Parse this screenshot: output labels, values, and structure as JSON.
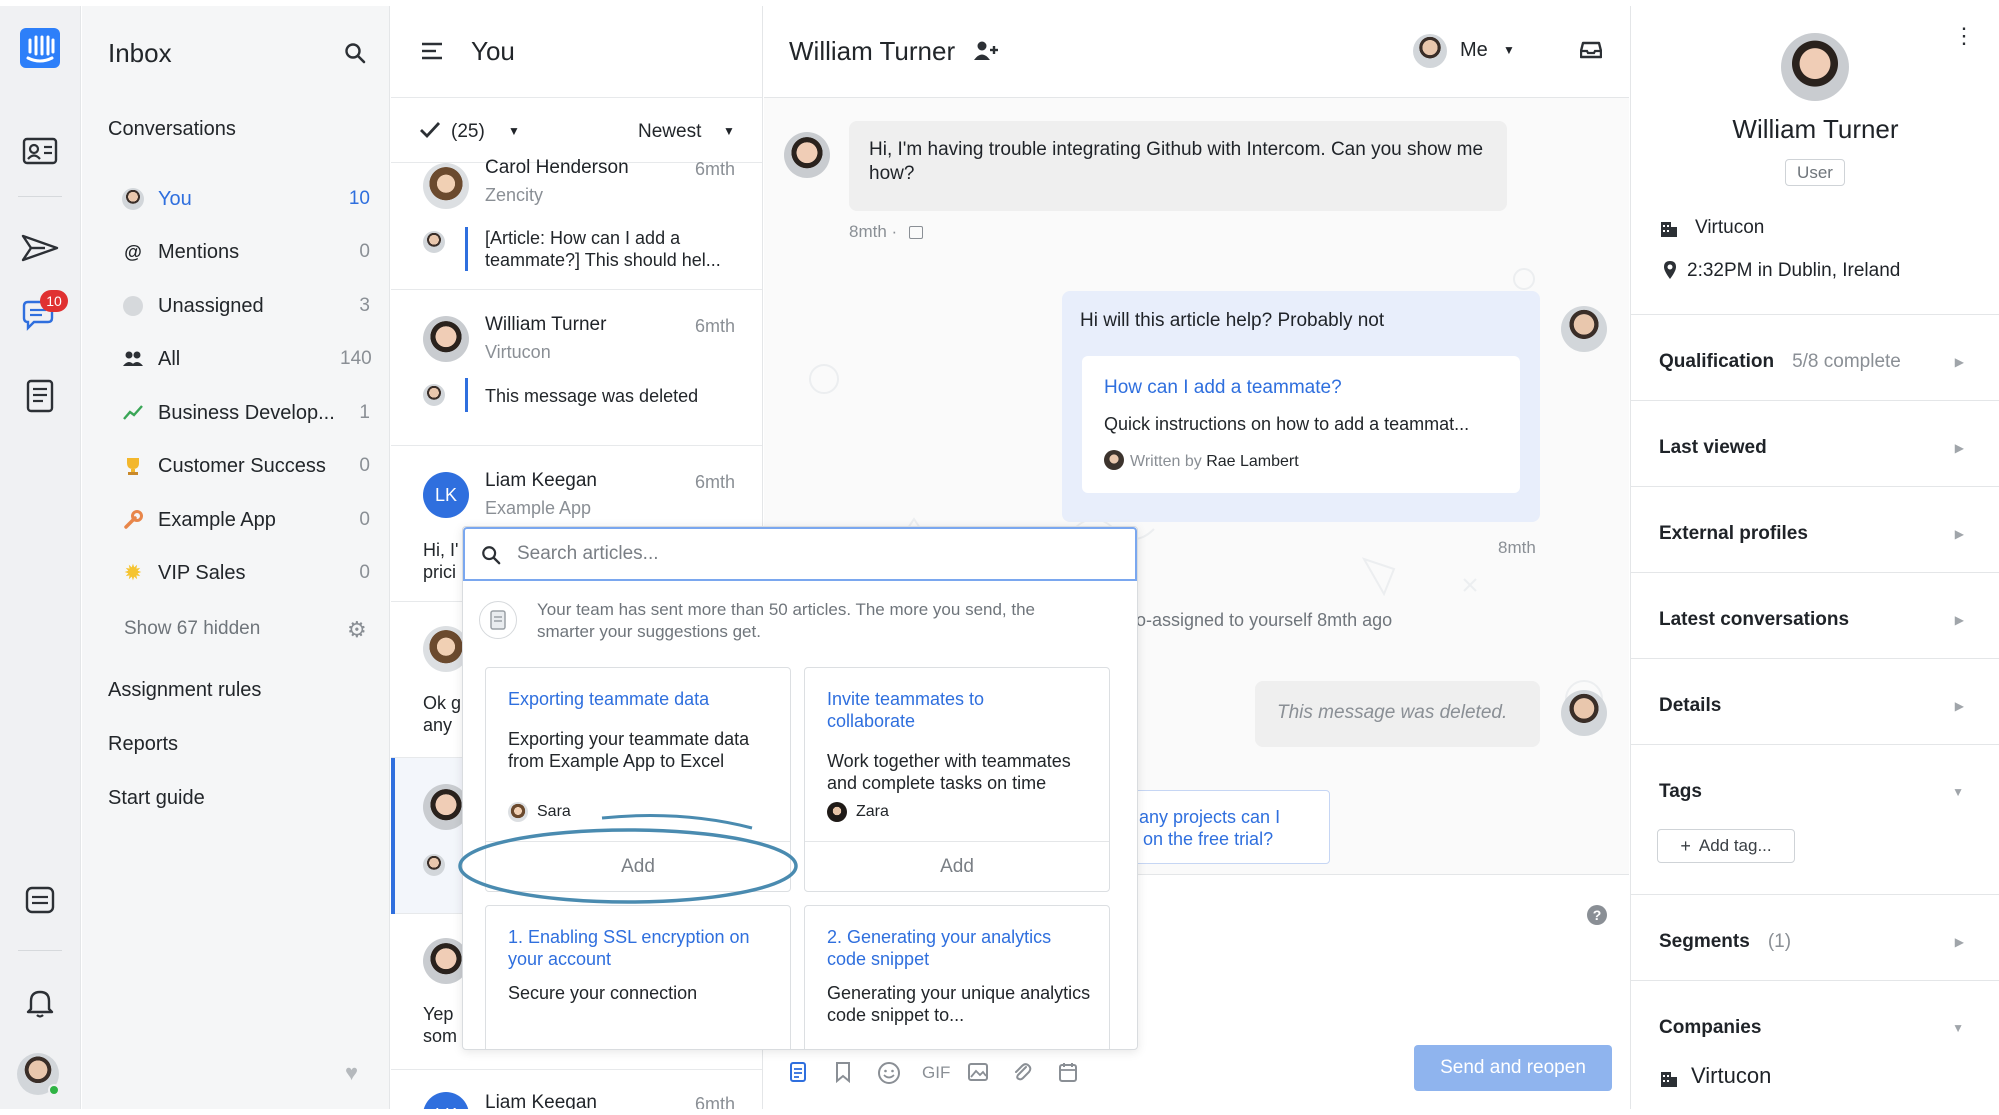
{
  "rail": {
    "notification_badge": "10"
  },
  "sidebar": {
    "title": "Inbox",
    "section_title": "Conversations",
    "items": [
      {
        "label": "You",
        "count": "10",
        "icon": "avatar-icon"
      },
      {
        "label": "Mentions",
        "count": "0",
        "icon": "at-icon"
      },
      {
        "label": "Unassigned",
        "count": "3",
        "icon": "person-icon"
      },
      {
        "label": "All",
        "count": "140",
        "icon": "people-icon"
      },
      {
        "label": "Business Develop...",
        "count": "1",
        "icon": "chart-icon"
      },
      {
        "label": "Customer Success",
        "count": "0",
        "icon": "trophy-icon"
      },
      {
        "label": "Example App",
        "count": "0",
        "icon": "wrench-icon"
      },
      {
        "label": "VIP Sales",
        "count": "0",
        "icon": "sun-icon"
      }
    ],
    "show_hidden": "Show 67 hidden",
    "links": [
      "Assignment rules",
      "Reports",
      "Start guide"
    ]
  },
  "convlist": {
    "title": "You",
    "count_filter": "(25)",
    "sort": "Newest",
    "items": [
      {
        "name": "Carol Henderson",
        "time": "6mth",
        "company": "Zencity",
        "preview": "[Article: How can I add a teammate?] This should hel..."
      },
      {
        "name": "William Turner",
        "time": "6mth",
        "company": "Virtucon",
        "preview": "This message was deleted"
      },
      {
        "name": "Liam Keegan",
        "time": "6mth",
        "company": "Example App",
        "initials": "LK",
        "preview_a": "Hi, I'",
        "preview_b": "prici"
      },
      {
        "preview_a": "Ok g",
        "preview_b": "any"
      },
      {
        "preview_a": "Yep",
        "preview_b": "som"
      },
      {
        "name": "Liam Keegan",
        "time": "6mth",
        "initials": "LK"
      }
    ]
  },
  "main": {
    "contact_name": "William Turner",
    "assignee": "Me",
    "msg1": "Hi, I'm having trouble integrating Github with Intercom. Can you show me how?",
    "msg1_time": "8mth ·",
    "msg2": "Hi will this article help? Probably not",
    "article_title": "How can I add a teammate?",
    "article_desc": "Quick instructions on how to add a teammat...",
    "article_written_by": "Written by",
    "article_author": "Rae Lambert",
    "msg2_time": "8mth",
    "event": "o-assigned to yourself 8mth ago",
    "deleted": "This message was deleted.",
    "suggestion_line1": "any projects can I",
    "suggestion_line2": "on the free trial?",
    "send_button": "Send and reopen",
    "gif_label": "GIF",
    "help_icon": "?"
  },
  "popup": {
    "search_placeholder": "Search articles...",
    "notice": "Your team has sent more than 50 articles. The more you send, the smarter your suggestions get.",
    "cards": [
      {
        "title": "Exporting teammate data",
        "desc": "Exporting your teammate data from Example App to Excel",
        "author": "Sara",
        "add": "Add"
      },
      {
        "title": "Invite teammates to collaborate",
        "desc": "Work together with teammates and complete tasks on time",
        "author": "Zara",
        "add": "Add"
      },
      {
        "title": "1. Enabling SSL encryption on your account",
        "desc": "Secure your connection"
      },
      {
        "title": "2. Generating your analytics code snippet",
        "desc": "Generating your unique analytics code snippet to..."
      }
    ]
  },
  "right": {
    "name": "William Turner",
    "badge": "User",
    "company": "Virtucon",
    "location": "2:32PM in Dublin, Ireland",
    "sections": [
      {
        "title": "Qualification",
        "sub": "5/8 complete"
      },
      {
        "title": "Last viewed"
      },
      {
        "title": "External profiles"
      },
      {
        "title": "Latest conversations"
      },
      {
        "title": "Details"
      },
      {
        "title": "Tags"
      },
      {
        "title": "Segments",
        "sub": "(1)"
      },
      {
        "title": "Companies"
      }
    ],
    "add_tag": "Add tag...",
    "company_bottom": "Virtucon"
  },
  "colors": {
    "accent": "#2f6fde",
    "send_button": "#8fb4ee",
    "annotation": "#4a8bb0"
  }
}
